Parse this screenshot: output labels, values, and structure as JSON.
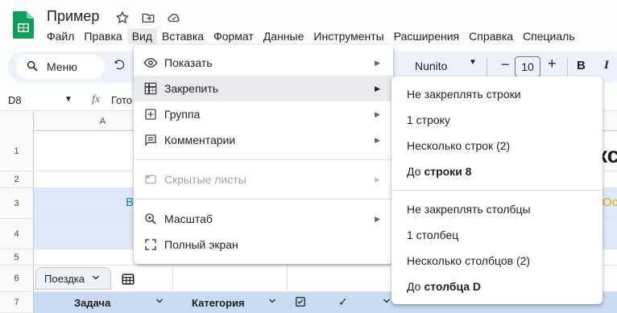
{
  "header": {
    "title": "Пример",
    "menu": [
      "Файл",
      "Правка",
      "Вид",
      "Вставка",
      "Формат",
      "Данные",
      "Инструменты",
      "Расширения",
      "Справка",
      "Специаль"
    ],
    "active_menu": "Вид"
  },
  "toolbar": {
    "search_label": "Меню",
    "font": "Nunito",
    "font_size": "10",
    "bold": "B",
    "italic": "I"
  },
  "formula": {
    "cell_ref": "D8",
    "fx": "fx",
    "content": "Гото"
  },
  "grid": {
    "col_a": "A",
    "rows": [
      "1",
      "2",
      "3",
      "4",
      "5",
      "6",
      "7"
    ],
    "cell_blue": "B",
    "cell_orange": "Ос",
    "big_text": "кс",
    "trip_tab": "Поездка",
    "header_task": "Задача",
    "header_category": "Категория",
    "header_tick": "✓"
  },
  "view_menu": {
    "items": [
      {
        "label": "Показать",
        "icon": "eye-icon"
      },
      {
        "label": "Закрепить",
        "icon": "freeze-grid-icon",
        "highlighted": true
      },
      {
        "label": "Группа",
        "icon": "plus-box-icon"
      },
      {
        "label": "Комментарии",
        "icon": "comment-icon"
      },
      {
        "label": "Скрытые листы",
        "icon": "hidden-sheet-icon",
        "disabled": true
      },
      {
        "label": "Масштаб",
        "icon": "zoom-icon"
      },
      {
        "label": "Полный экран",
        "icon": "fullscreen-icon"
      }
    ]
  },
  "freeze_menu": {
    "rows_none": "Не закреплять строки",
    "rows_one": "1 строку",
    "rows_several": "Несколько строк (2)",
    "rows_upto_prefix": "До",
    "rows_upto_bold": "строки 8",
    "cols_none": "Не закреплять столбцы",
    "cols_one": "1 столбец",
    "cols_several": "Несколько столбцов (2)",
    "cols_upto_prefix": "До",
    "cols_upto_bold": "столбца D"
  },
  "colors": {
    "sheets_green": "#0f9d58",
    "selected_header": "#c9dbf3",
    "menu_highlight": "#e8eaed",
    "toolbar_bg": "#edf2fa"
  }
}
